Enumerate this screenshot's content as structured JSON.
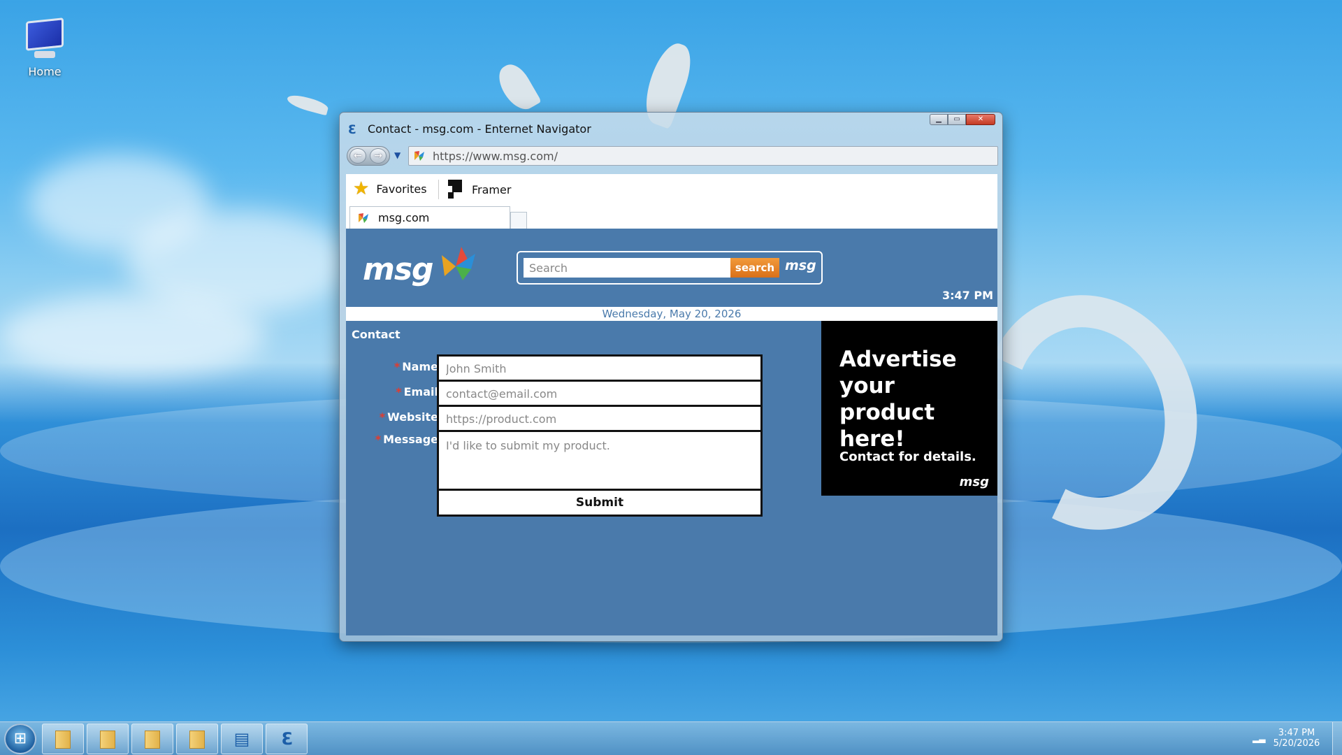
{
  "desktop": {
    "icons": [
      {
        "label": "Home",
        "icon": "computer-icon"
      }
    ]
  },
  "window": {
    "title": "Contact - msg.com - Enternet Navigator",
    "address": "https://www.msg.com/",
    "favorites": [
      {
        "label": "Favorites",
        "icon": "star-icon"
      },
      {
        "label": "Framer",
        "icon": "framer-icon"
      }
    ],
    "tab": {
      "label": "msg.com"
    }
  },
  "site": {
    "logo": "msg",
    "search": {
      "placeholder": "Search",
      "button": "search",
      "brand": "msg"
    },
    "time": "3:47 PM",
    "date": "Wednesday, May 20, 2026",
    "section_title": "Contact",
    "form": {
      "name": {
        "label": "Name",
        "placeholder": "John Smith"
      },
      "email": {
        "label": "Email",
        "placeholder": "contact@email.com"
      },
      "website": {
        "label": "Website",
        "placeholder": "https://product.com"
      },
      "message": {
        "label": "Message",
        "placeholder": "I'd like to submit my product."
      },
      "submit": "Submit"
    },
    "ad": {
      "headline": "Advertise your product here!",
      "subtext": "Contact for details.",
      "brand": "msg"
    },
    "colors": {
      "page_bg": "#4a7aab",
      "search_button": "#e2801f",
      "ad_bg": "#000000",
      "required_marker": "#e23b2e"
    }
  },
  "taskbar": {
    "pinned": [
      "folder-icon",
      "folder-icon",
      "folder-icon",
      "folder-icon",
      "text-editor-icon",
      "browser-icon"
    ],
    "clock_time": "3:47 PM",
    "clock_date": "5/20/2026"
  }
}
